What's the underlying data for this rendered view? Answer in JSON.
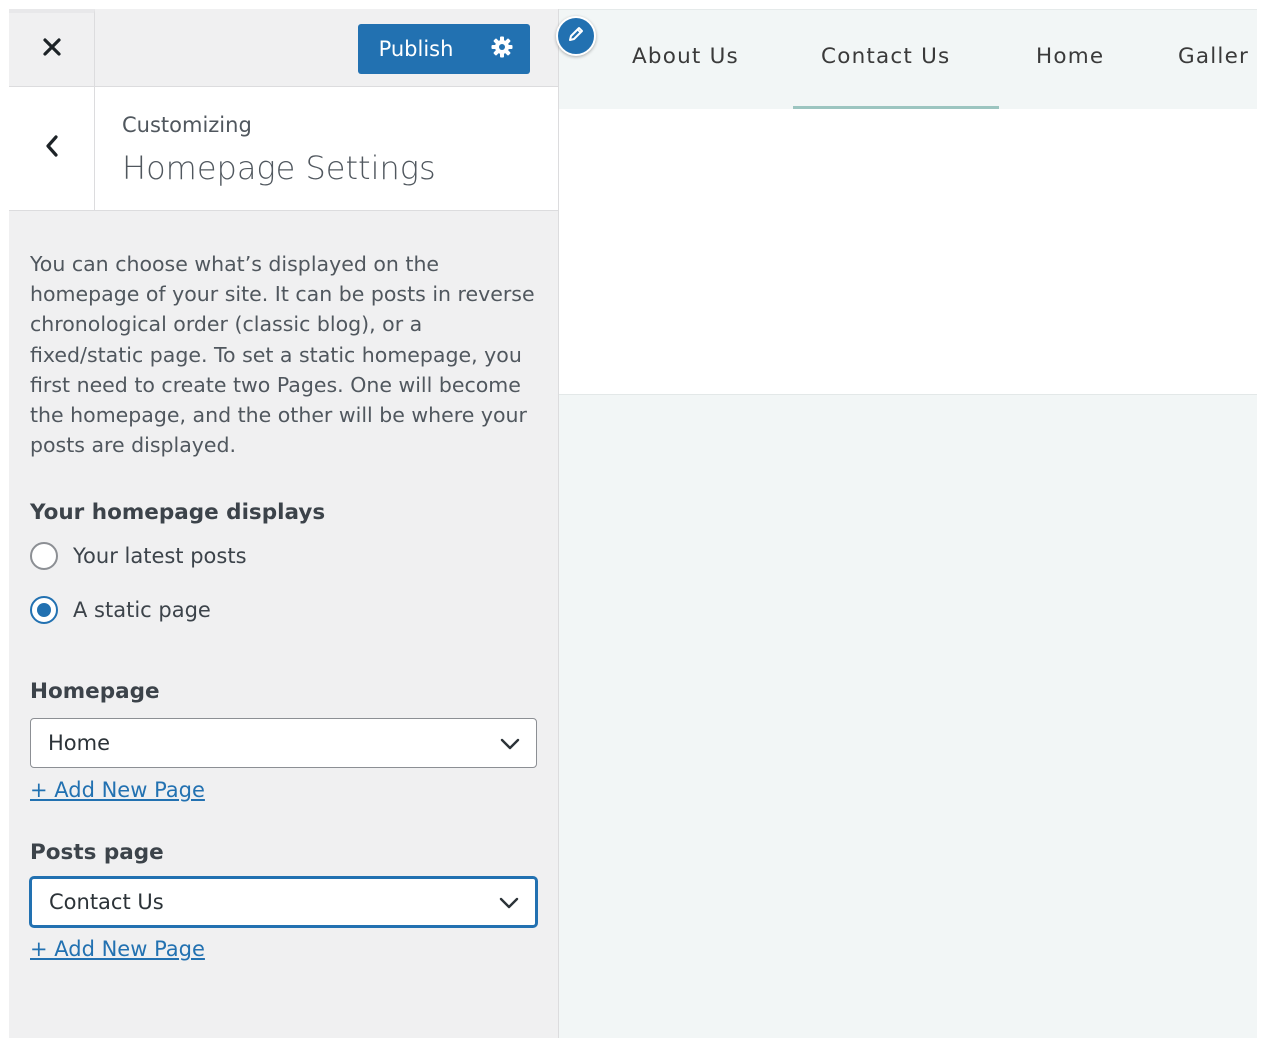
{
  "topbar": {
    "close_icon": "close-icon",
    "publish_label": "Publish",
    "settings_icon": "gear-icon"
  },
  "header": {
    "back_icon": "chevron-left-icon",
    "customizing_label": "Customizing",
    "section_title": "Homepage Settings"
  },
  "content": {
    "description": "You can choose what’s displayed on the homepage of your site. It can be posts in reverse chronological order (classic blog), or a fixed/static page. To set a static homepage, you first need to create two Pages. One will become the homepage, and the other will be where your posts are displayed.",
    "displays_title": "Your homepage displays",
    "radio_options": [
      {
        "label": "Your latest posts",
        "checked": false
      },
      {
        "label": "A static page",
        "checked": true
      }
    ],
    "homepage_title": "Homepage",
    "homepage_value": "Home",
    "add_new_page_1": "+ Add New Page",
    "posts_page_title": "Posts page",
    "posts_page_value": "Contact Us",
    "add_new_page_2": "+ Add New Page"
  },
  "preview": {
    "edit_icon": "pencil-icon",
    "nav_items": [
      "About Us",
      "Contact Us",
      "Home",
      "Galler"
    ],
    "active_nav": "Contact Us"
  },
  "colors": {
    "accent": "#2271b1",
    "sidebar_bg": "#f0f0f1",
    "preview_bg": "#f2f6f6",
    "nav_underline": "#9cc5c0"
  }
}
